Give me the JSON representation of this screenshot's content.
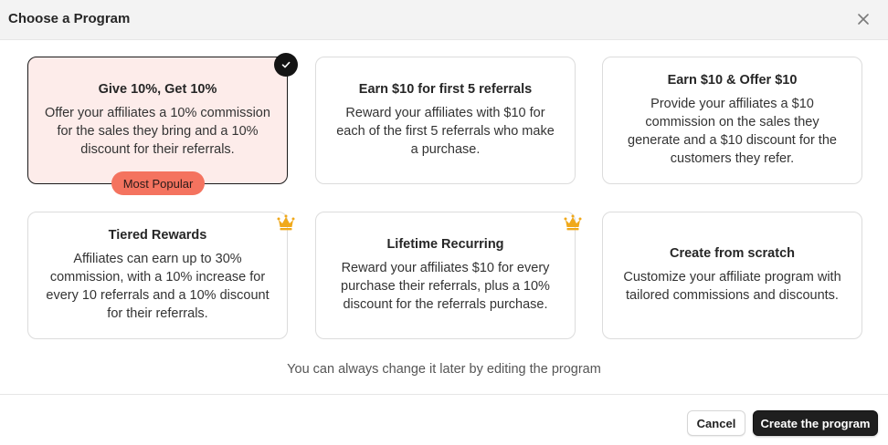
{
  "dialog": {
    "title": "Choose a Program",
    "close_icon": "close-icon"
  },
  "programs": [
    {
      "title": "Give 10%, Get 10%",
      "description": "Offer your affiliates a 10% commission for the sales they bring and a 10% discount for their referrals.",
      "selected": true,
      "badge": "Most Popular",
      "premium": false
    },
    {
      "title": "Earn $10 for first 5 referrals",
      "description": "Reward your affiliates with $10 for each of the first 5 referrals who make a purchase.",
      "selected": false,
      "premium": false
    },
    {
      "title": "Earn $10 & Offer $10",
      "description": "Provide your affiliates a $10 commission on the sales they generate and a $10 discount for the customers they refer.",
      "selected": false,
      "premium": false
    },
    {
      "title": "Tiered Rewards",
      "description": "Affiliates can earn up to 30% commission, with a 10% increase for every 10 referrals and a 10% discount for their referrals.",
      "selected": false,
      "premium": true
    },
    {
      "title": "Lifetime Recurring",
      "description": "Reward your affiliates $10 for every purchase their referrals, plus a 10% discount for the referrals purchase.",
      "selected": false,
      "premium": true
    },
    {
      "title": "Create from scratch",
      "description": "Customize your affiliate program with tailored commissions and discounts.",
      "selected": false,
      "premium": false
    }
  ],
  "hint": "You can always change it later by editing the program",
  "footer": {
    "cancel_label": "Cancel",
    "create_label": "Create the program"
  },
  "colors": {
    "selected_bg": "#fdecea",
    "badge_bg": "#f4735f",
    "crown": "#f0a91b",
    "primary_button": "#1f1f1f"
  }
}
